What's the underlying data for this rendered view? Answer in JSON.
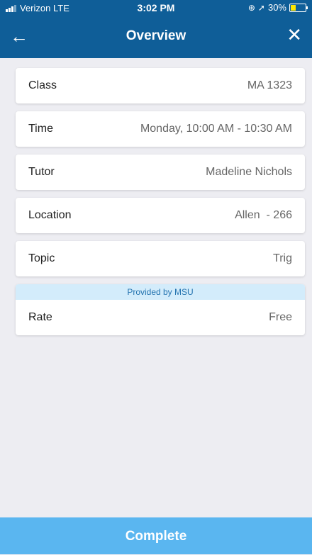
{
  "status_bar": {
    "carrier": "Verizon",
    "network": "LTE",
    "time": "3:02 PM",
    "lock_glyph": "⊕",
    "location_glyph": "➚",
    "battery": "30%"
  },
  "nav": {
    "title": "Overview",
    "back_icon": "←",
    "close_icon": "✕"
  },
  "rows": [
    {
      "label": "Class",
      "value": "MA 1323"
    },
    {
      "label": "Time",
      "value": "Monday, 10:00 AM - 10:30 AM"
    },
    {
      "label": "Tutor",
      "value": "Madeline Nichols"
    },
    {
      "label": "Location",
      "value": "Allen  - 266"
    },
    {
      "label": "Topic",
      "value": "Trig"
    }
  ],
  "rate": {
    "provider_banner": "Provided by MSU",
    "label": "Rate",
    "value": "Free"
  },
  "footer": {
    "complete_label": "Complete"
  },
  "colors": {
    "header": "#0f5e98",
    "complete_button": "#5ab6f0",
    "banner": "#d3ecfb",
    "background": "#ededf2"
  }
}
